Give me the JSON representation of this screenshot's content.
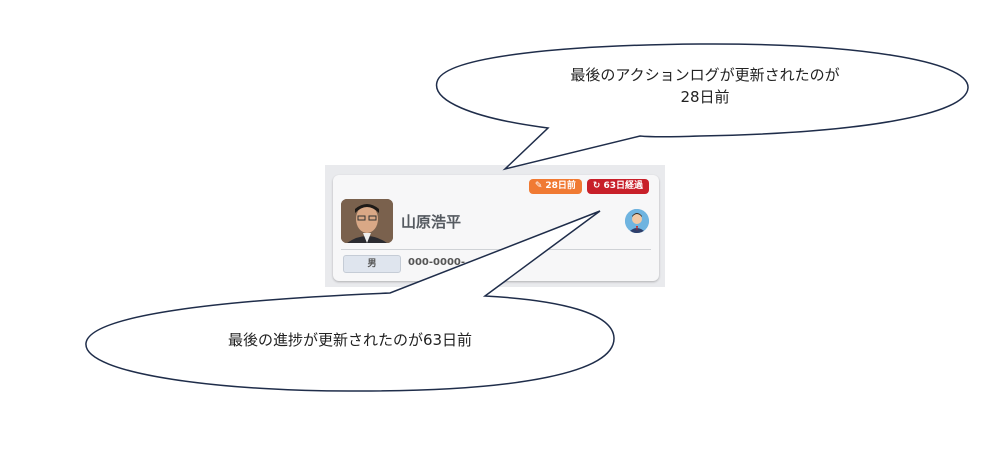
{
  "card": {
    "badge_action": "28日前",
    "badge_progress": "63日経過",
    "name": "山原浩平",
    "gender": "男",
    "phone": "000-0000-"
  },
  "callouts": {
    "top_line1": "最後のアクションログが更新されたのが",
    "top_line2": "28日前",
    "bottom": "最後の進捗が更新されたのが63日前"
  },
  "colors": {
    "badge_action": "#f07a33",
    "badge_progress": "#c8202a",
    "callout_stroke": "#1f2d4a"
  }
}
